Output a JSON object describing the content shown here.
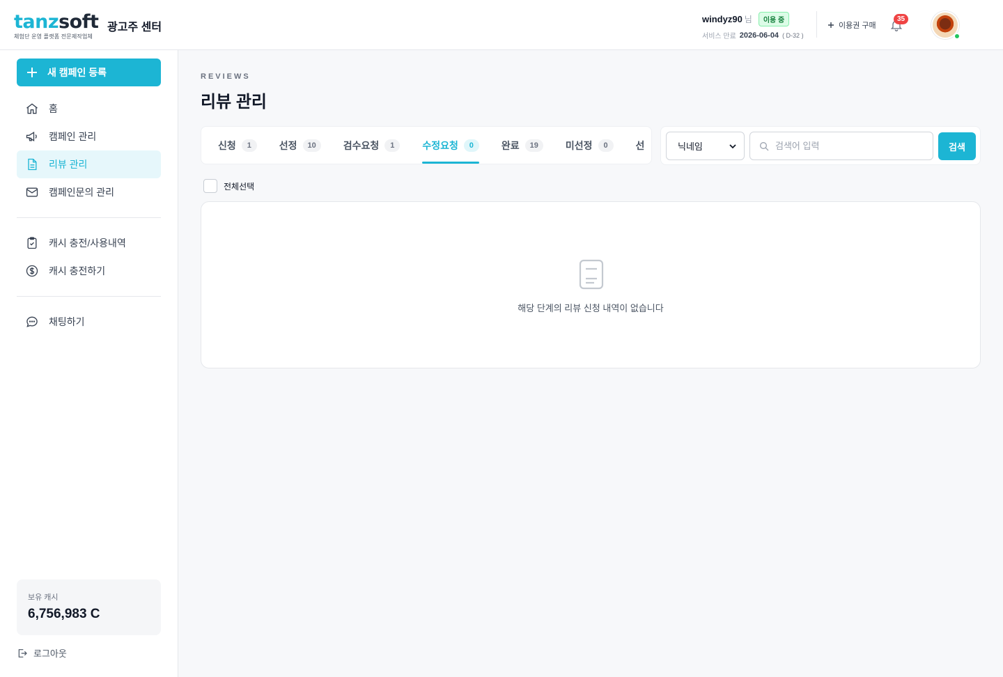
{
  "brand": {
    "logo_part1": "tanz",
    "logo_part2": "soft",
    "tagline": "체험단 운영 플랫폼 전문제작업체",
    "center_title": "광고주 센터",
    "accent_color": "#1cb5d4"
  },
  "user": {
    "username": "windyz90",
    "suffix": "님",
    "status": "이용 중",
    "expire_label": "서비스 만료",
    "expire_date": "2026-06-04",
    "dday": "( D-32 )",
    "buy_label": "이용권 구매",
    "notification_count": "35",
    "avatar_icon": "avatar-photo"
  },
  "sidebar": {
    "new_campaign_label": "새 캠페인 등록",
    "items": [
      {
        "label": "홈",
        "icon": "home-icon"
      },
      {
        "label": "캠페인 관리",
        "icon": "megaphone-icon"
      },
      {
        "label": "리뷰 관리",
        "icon": "document-icon",
        "active": true
      },
      {
        "label": "캠페인문의 관리",
        "icon": "mail-icon"
      },
      {
        "label": "캐시 충전/사용내역",
        "icon": "clipboard-check-icon"
      },
      {
        "label": "캐시 충전하기",
        "icon": "dollar-icon"
      },
      {
        "label": "채팅하기",
        "icon": "chat-icon"
      }
    ],
    "cash_label": "보유 캐시",
    "cash_value": "6,756,983 C",
    "logout_label": "로그아웃"
  },
  "main": {
    "eyebrow": "REVIEWS",
    "title": "리뷰 관리",
    "tabs": [
      {
        "label": "신청",
        "count": "1"
      },
      {
        "label": "선정",
        "count": "10"
      },
      {
        "label": "검수요청",
        "count": "1"
      },
      {
        "label": "수정요청",
        "count": "0",
        "active": true
      },
      {
        "label": "완료",
        "count": "19"
      },
      {
        "label": "미선정",
        "count": "0"
      },
      {
        "label": "선",
        "count": ""
      }
    ],
    "search": {
      "select_value": "닉네임",
      "placeholder": "검색어 입력",
      "button_label": "검색"
    },
    "select_all_label": "전체선택",
    "empty_message": "해당 단계의 리뷰 신청 내역이 없습니다"
  }
}
